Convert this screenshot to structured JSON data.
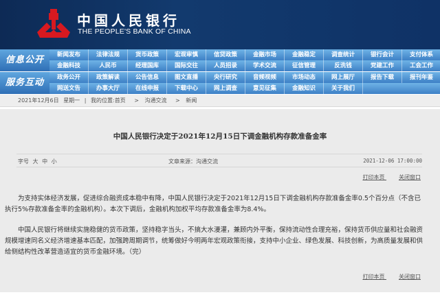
{
  "header": {
    "cn_name": "中国人民银行",
    "en_name": "THE PEOPLE'S BANK OF CHINA",
    "logo_color": "#d71920"
  },
  "nav": {
    "bands": [
      {
        "label": "信息公开",
        "rows": [
          [
            "新闻发布",
            "法律法规",
            "货币政策",
            "宏观审慎",
            "信贷政策",
            "金融市场",
            "金融稳定",
            "调查统计",
            "银行会计",
            "支付体系"
          ],
          [
            "金融科技",
            "人民币",
            "经理国库",
            "国际交往",
            "人员招录",
            "学术交流",
            "征信管理",
            "反洗钱",
            "党建工作",
            "工会工作"
          ]
        ]
      },
      {
        "label": "服务互动",
        "rows": [
          [
            "政务公开",
            "政策解读",
            "公告信息",
            "图文直播",
            "央行研究",
            "音频视频",
            "市场动态",
            "网上展厅",
            "报告下载",
            "报刊年鉴"
          ],
          [
            "网送文告",
            "办事大厅",
            "在线申报",
            "下载中心",
            "网上调查",
            "意见征集",
            "金融知识",
            "关于我们"
          ]
        ]
      }
    ]
  },
  "breadcrumb": {
    "date": "2021年12月6日",
    "weekday": "星期一",
    "sep": "|",
    "location_label": "我的位置:",
    "items": [
      "首页",
      "沟通交流",
      "新闻"
    ],
    "arrow": ">"
  },
  "article": {
    "title": "中国人民银行决定于2021年12月15日下调金融机构存款准备金率",
    "font_label": "字号",
    "font_sizes": [
      "大",
      "中",
      "小"
    ],
    "source": "文章来源：沟通交流",
    "datetime": "2021-12-06 17:00:00",
    "print": "打印本页",
    "close": "关闭窗口",
    "paragraphs": [
      "为支持实体经济发展，促进综合融资成本稳中有降，中国人民银行决定于2021年12月15日下调金融机构存款准备金率0.5个百分点（不含已执行5%存款准备金率的金融机构）。本次下调后，金融机构加权平均存款准备金率为8.4%。",
      "中国人民银行将继续实施稳健的货币政策，坚持稳字当头，不搞大水漫灌，兼顾内外平衡，保持流动性合理充裕，保持货币供应量和社会融资规模增速同名义经济增速基本匹配，加强跨周期调节，统筹做好今明两年宏观政策衔接，支持中小企业、绿色发展、科技创新，为高质量发展和供给侧结构性改革营造适宜的货币金融环境。（完）"
    ]
  }
}
